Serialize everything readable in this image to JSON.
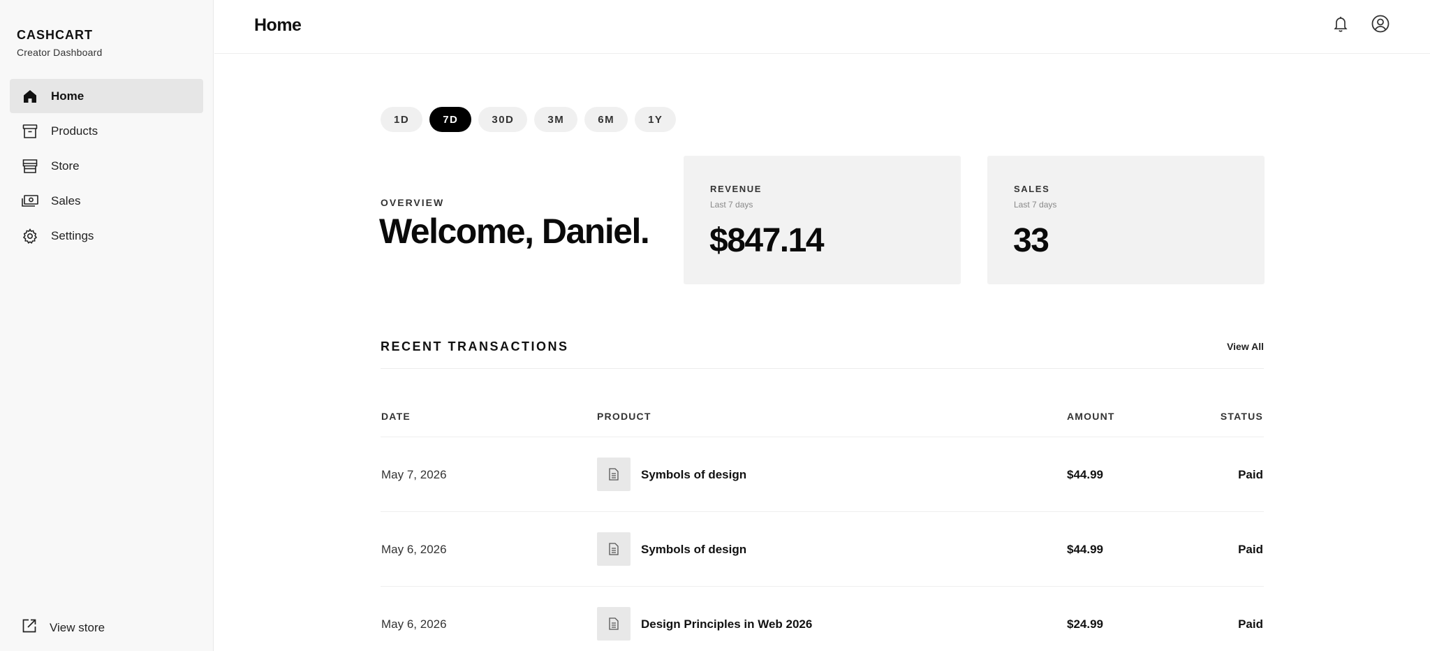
{
  "brand": {
    "name": "CASHCART",
    "subtitle": "Creator Dashboard"
  },
  "sidebar": {
    "items": [
      {
        "label": "Home",
        "icon": "home-icon",
        "active": true
      },
      {
        "label": "Products",
        "icon": "archive-box-icon",
        "active": false
      },
      {
        "label": "Store",
        "icon": "storefront-icon",
        "active": false
      },
      {
        "label": "Sales",
        "icon": "cash-icon",
        "active": false
      },
      {
        "label": "Settings",
        "icon": "gear-icon",
        "active": false
      }
    ],
    "footer": {
      "label": "View store",
      "icon": "external-link-icon"
    }
  },
  "header": {
    "title": "Home",
    "icons": [
      "bell-icon",
      "user-circle-icon"
    ]
  },
  "ranges": {
    "options": [
      "1D",
      "7D",
      "30D",
      "3M",
      "6M",
      "1Y"
    ],
    "selected": "7D"
  },
  "overview": {
    "label": "OVERVIEW",
    "greeting": "Welcome, Daniel."
  },
  "stats": {
    "revenue": {
      "label": "REVENUE",
      "period": "Last 7 days",
      "value": "$847.14"
    },
    "sales": {
      "label": "SALES",
      "period": "Last 7 days",
      "value": "33"
    }
  },
  "transactions": {
    "title": "RECENT TRANSACTIONS",
    "view_all": "View All",
    "columns": {
      "date": "DATE",
      "product": "PRODUCT",
      "amount": "AMOUNT",
      "status": "STATUS"
    },
    "rows": [
      {
        "date": "May 7, 2026",
        "product": "Symbols of design",
        "amount": "$44.99",
        "status": "Paid"
      },
      {
        "date": "May 6, 2026",
        "product": "Symbols of design",
        "amount": "$44.99",
        "status": "Paid"
      },
      {
        "date": "May 6, 2026",
        "product": "Design Principles in Web 2026",
        "amount": "$24.99",
        "status": "Paid"
      }
    ]
  },
  "colors": {
    "sidebar_bg": "#f8f8f8",
    "active_nav_bg": "#e6e6e6",
    "card_bg": "#f2f2f2",
    "pill_bg": "#f0f0f0",
    "pill_active_bg": "#000000",
    "text": "#111111"
  }
}
